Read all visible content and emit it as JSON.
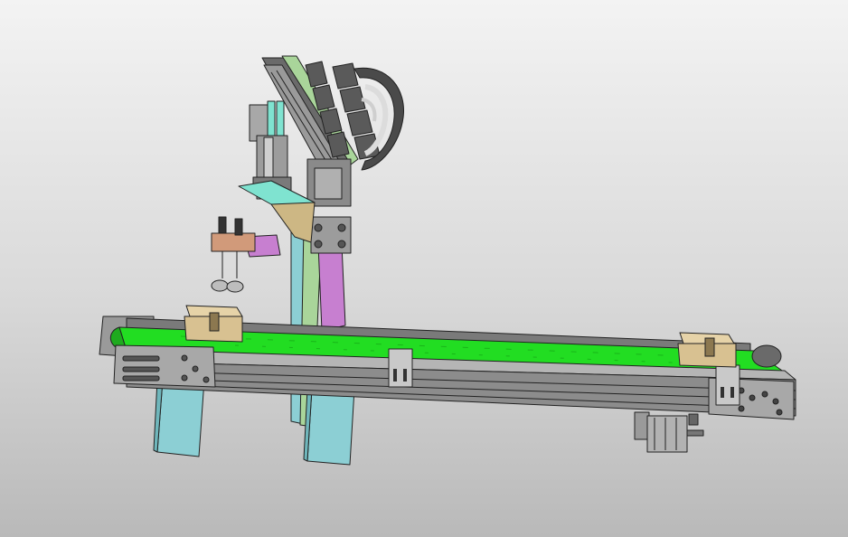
{
  "scene": {
    "colors": {
      "background_top": "#f3f3f3",
      "background_bottom": "#b9b9b9",
      "belt": "#22dd22",
      "frame_steel": "#8c8c8c",
      "frame_dark": "#5a5a5a",
      "leg_cyan": "#8ccfd4",
      "plate_teal": "#7fe3d0",
      "plate_green": "#a9d59a",
      "plate_magenta": "#c77fd0",
      "plate_tan": "#cdb784",
      "plate_copper": "#d19a7a",
      "workpiece_tan": "#d8c191",
      "drag_chain": "#4a4a4a"
    },
    "parts": [
      "belt-conveyor",
      "conveyor-legs",
      "gantry-column",
      "linear-slide",
      "cable-drag-chain",
      "pneumatic-cylinder",
      "vacuum-suction-cups",
      "workpiece-blocks",
      "drive-motor"
    ]
  }
}
